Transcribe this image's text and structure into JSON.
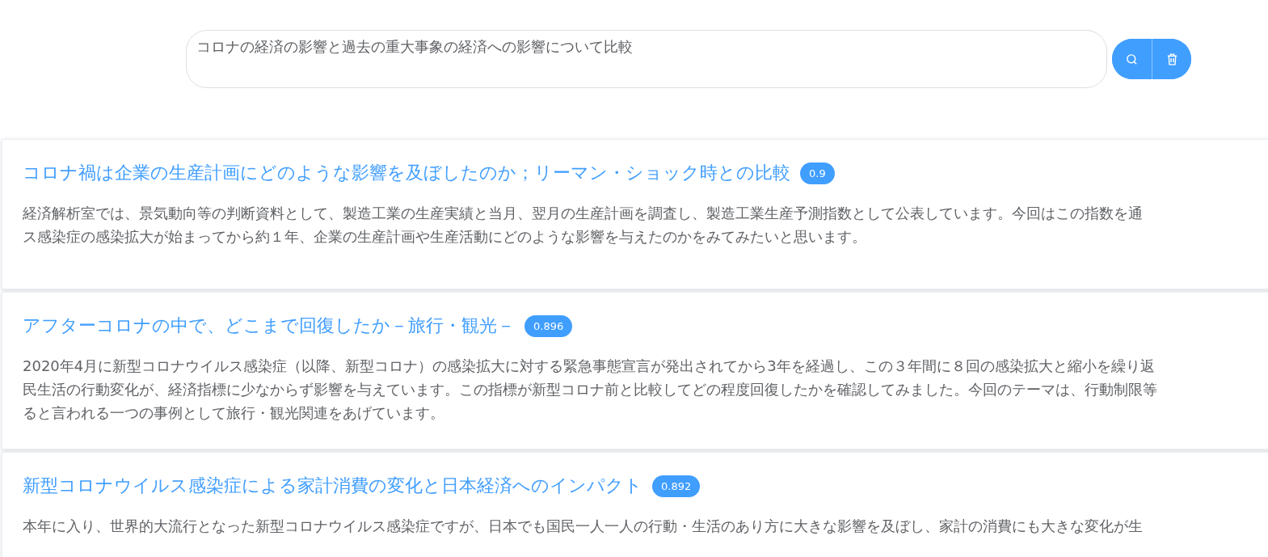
{
  "search": {
    "value": "コロナの経済の影響と過去の重大事象の経済への影響について比較"
  },
  "results": [
    {
      "title": "コロナ禍は企業の生産計画にどのような影響を及ぼしたのか；リーマン・ショック時との比較",
      "score": "0.9",
      "lines": [
        "経済解析室では、景気動向等の判断資料として、製造工業の生産実績と当月、翌月の生産計画を調査し、製造工業生産予測指数として公表しています。今回はこの指数を通",
        "ス感染症の感染拡大が始まってから約１年、企業の生産計画や生産活動にどのような影響を与えたのかをみてみたいと思います。"
      ]
    },
    {
      "title": "アフターコロナの中で、どこまで回復したか－旅行・観光－",
      "score": "0.896",
      "lines": [
        "2020年4月に新型コロナウイルス感染症（以降、新型コロナ）の感染拡大に対する緊急事態宣言が発出されてから3年を経過し、この３年間に８回の感染拡大と縮小を繰り返",
        "民生活の行動変化が、経済指標に少なからず影響を与えています。この指標が新型コロナ前と比較してどの程度回復したかを確認してみました。今回のテーマは、行動制限等",
        "ると言われる一つの事例として旅行・観光関連をあげています。"
      ]
    },
    {
      "title": "新型コロナウイルス感染症による家計消費の変化と日本経済へのインパクト",
      "score": "0.892",
      "lines": [
        "本年に入り、世界的大流行となった新型コロナウイルス感染症ですが、日本でも国民一人一人の行動・生活のあり方に大きな影響を及ぼし、家計の消費にも大きな変化が生"
      ]
    }
  ]
}
